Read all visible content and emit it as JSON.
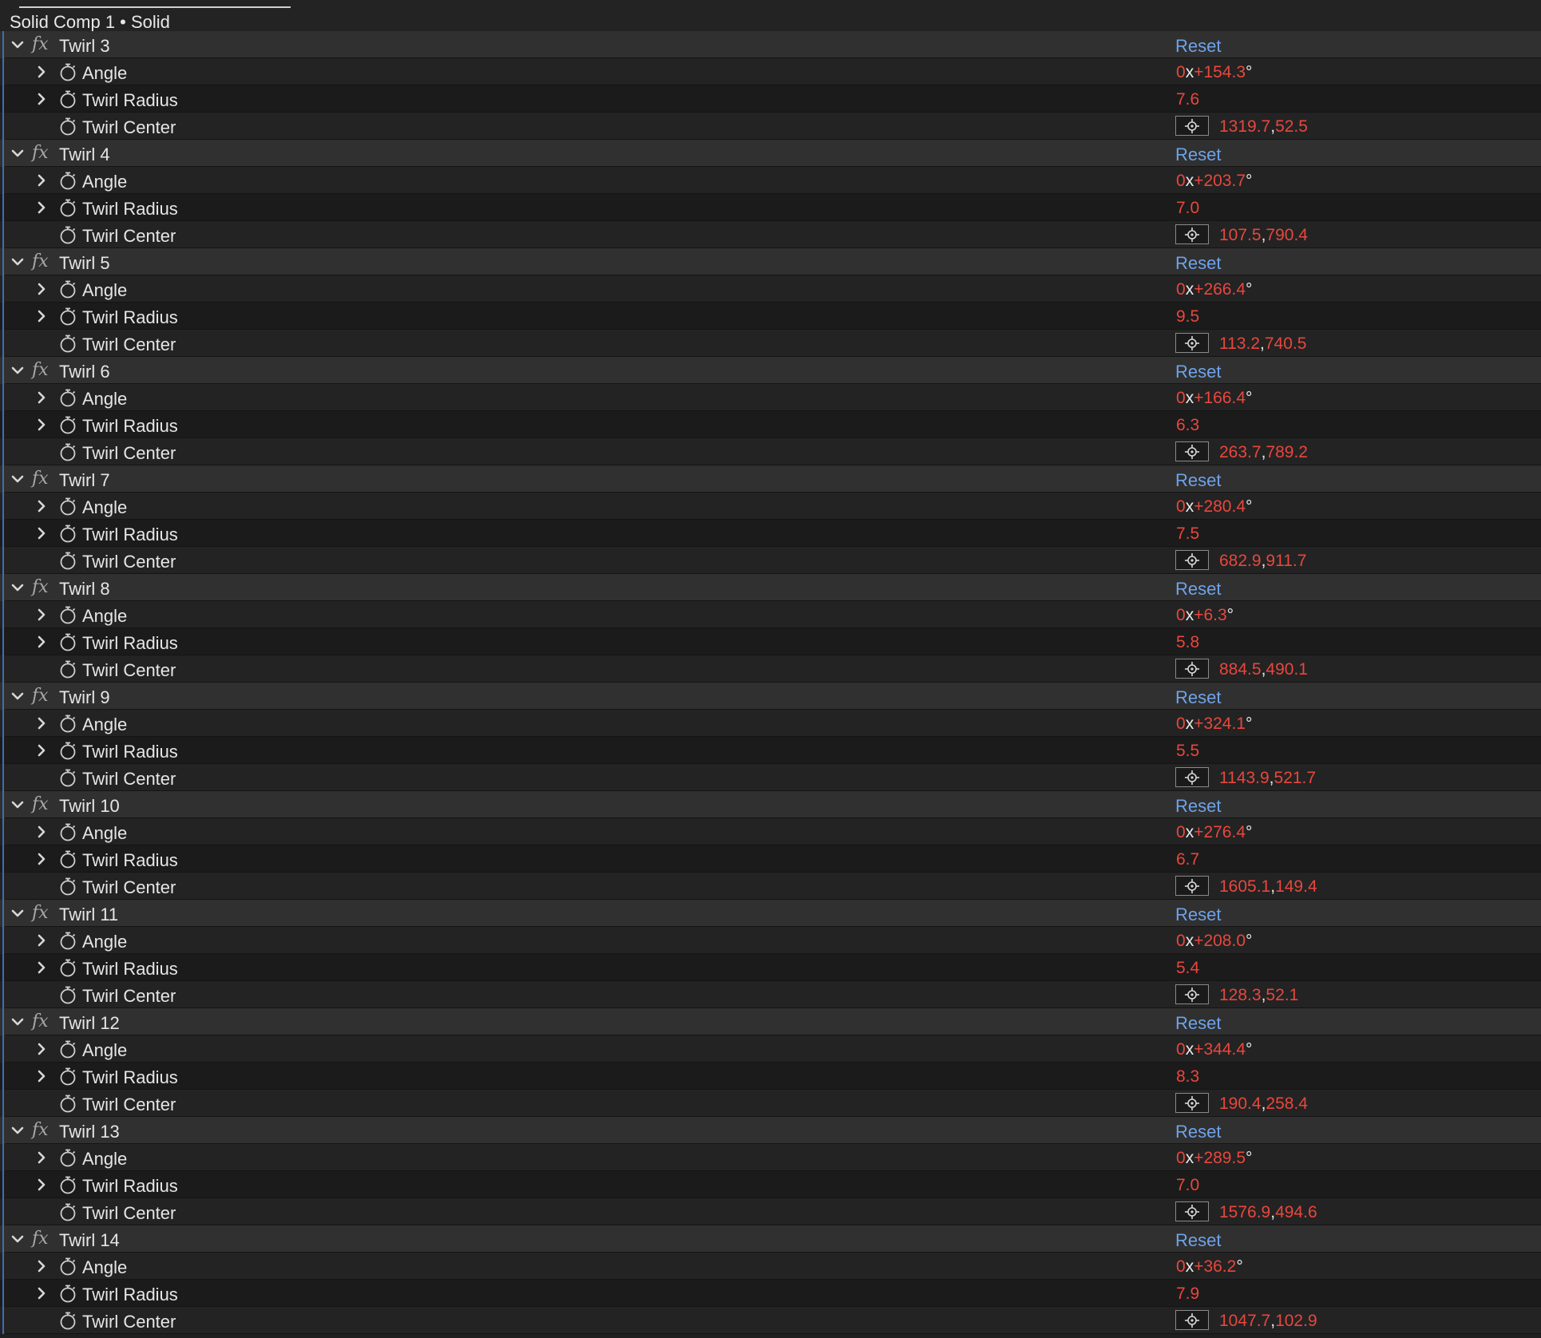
{
  "panel": {
    "title": "Solid Comp 1 • Solid",
    "reset_label": "Reset",
    "property_labels": {
      "angle": "Angle",
      "radius": "Twirl Radius",
      "center": "Twirl Center"
    },
    "angle_prefix": "0",
    "angle_x": "x",
    "degree": "°",
    "comma": ",",
    "colors": {
      "value": "#e8473d",
      "reset_link": "#6ea3ea",
      "header_row": "#303030"
    },
    "icons": {
      "caret": "chevron-down-icon",
      "expander": "chevron-right-icon",
      "fx": "fx-icon",
      "stopwatch": "stopwatch-icon",
      "target": "crosshair-target-icon"
    }
  },
  "effects": [
    {
      "name": "Twirl 3",
      "angle": "+154.3",
      "radius": "7.6",
      "center_x": "1319.7",
      "center_y": "52.5"
    },
    {
      "name": "Twirl 4",
      "angle": "+203.7",
      "radius": "7.0",
      "center_x": "107.5",
      "center_y": "790.4"
    },
    {
      "name": "Twirl 5",
      "angle": "+266.4",
      "radius": "9.5",
      "center_x": "113.2",
      "center_y": "740.5"
    },
    {
      "name": "Twirl 6",
      "angle": "+166.4",
      "radius": "6.3",
      "center_x": "263.7",
      "center_y": "789.2"
    },
    {
      "name": "Twirl 7",
      "angle": "+280.4",
      "radius": "7.5",
      "center_x": "682.9",
      "center_y": "911.7"
    },
    {
      "name": "Twirl 8",
      "angle": "+6.3",
      "radius": "5.8",
      "center_x": "884.5",
      "center_y": "490.1"
    },
    {
      "name": "Twirl 9",
      "angle": "+324.1",
      "radius": "5.5",
      "center_x": "1143.9",
      "center_y": "521.7"
    },
    {
      "name": "Twirl 10",
      "angle": "+276.4",
      "radius": "6.7",
      "center_x": "1605.1",
      "center_y": "149.4"
    },
    {
      "name": "Twirl 11",
      "angle": "+208.0",
      "radius": "5.4",
      "center_x": "128.3",
      "center_y": "52.1"
    },
    {
      "name": "Twirl 12",
      "angle": "+344.4",
      "radius": "8.3",
      "center_x": "190.4",
      "center_y": "258.4"
    },
    {
      "name": "Twirl 13",
      "angle": "+289.5",
      "radius": "7.0",
      "center_x": "1576.9",
      "center_y": "494.6"
    },
    {
      "name": "Twirl 14",
      "angle": "+36.2",
      "radius": "7.9",
      "center_x": "1047.7",
      "center_y": "102.9"
    }
  ]
}
